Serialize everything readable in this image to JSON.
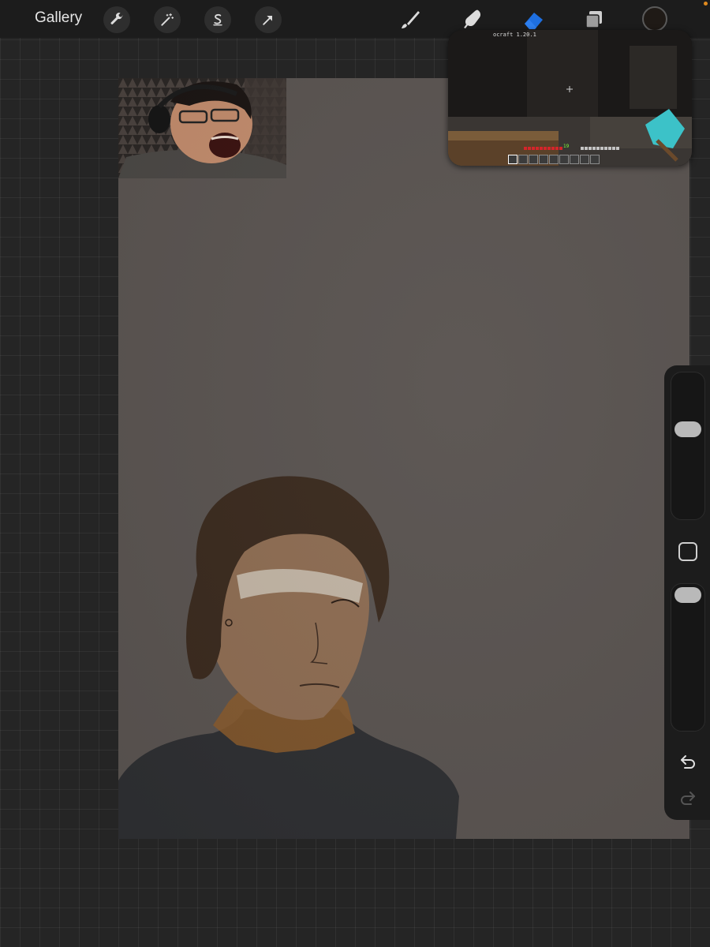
{
  "toolbar": {
    "gallery_label": "Gallery",
    "left_tools": [
      {
        "name": "actions",
        "icon": "wrench-icon"
      },
      {
        "name": "adjustments",
        "icon": "magic-wand-icon"
      },
      {
        "name": "selection",
        "icon": "selection-s-icon"
      },
      {
        "name": "transform",
        "icon": "arrow-cursor-icon"
      }
    ],
    "right_tools": [
      {
        "name": "paint",
        "icon": "brush-icon",
        "active": false
      },
      {
        "name": "smudge",
        "icon": "smudge-finger-icon",
        "active": false
      },
      {
        "name": "erase",
        "icon": "eraser-icon",
        "active": true
      },
      {
        "name": "layers",
        "icon": "layers-icon",
        "active": false
      }
    ],
    "current_color": "#1f1a16",
    "active_tool_color": "#1e6fe0"
  },
  "pip": {
    "version_text": "ocraft 1.20.1",
    "xp_level": "19"
  },
  "side_panel": {
    "brush_size_level": 0.64,
    "opacity_level": 1.0,
    "undo_icon": "undo-arrow-icon",
    "redo_icon": "redo-arrow-icon",
    "modifier_icon": "square-modifier-icon"
  }
}
